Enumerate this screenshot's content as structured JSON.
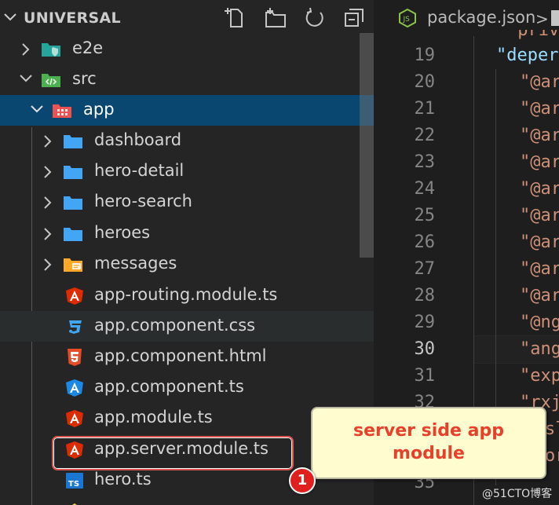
{
  "explorer": {
    "title": "UNIVERSAL",
    "rows": [
      {
        "label": "e2e",
        "icon": "folder-e2e-icon",
        "chevron": "right"
      },
      {
        "label": "src",
        "icon": "folder-src-icon",
        "chevron": "down"
      },
      {
        "label": "app",
        "icon": "folder-app-icon",
        "chevron": "down"
      },
      {
        "label": "dashboard",
        "icon": "folder-icon",
        "chevron": "right"
      },
      {
        "label": "hero-detail",
        "icon": "folder-icon",
        "chevron": "right"
      },
      {
        "label": "hero-search",
        "icon": "folder-icon",
        "chevron": "right"
      },
      {
        "label": "heroes",
        "icon": "folder-icon",
        "chevron": "right"
      },
      {
        "label": "messages",
        "icon": "folder-messages-icon",
        "chevron": "right"
      },
      {
        "label": "app-routing.module.ts",
        "icon": "angular-icon"
      },
      {
        "label": "app.component.css",
        "icon": "css-icon"
      },
      {
        "label": "app.component.html",
        "icon": "html-icon"
      },
      {
        "label": "app.component.ts",
        "icon": "angular-component-icon"
      },
      {
        "label": "app.module.ts",
        "icon": "angular-icon"
      },
      {
        "label": "app.server.module.ts",
        "icon": "angular-icon"
      },
      {
        "label": "hero.ts",
        "icon": "typescript-icon"
      }
    ]
  },
  "editor": {
    "tab_label": "package.json",
    "crumb_separator": ">",
    "line_numbers": [
      "19",
      "20",
      "21",
      "22",
      "23",
      "24",
      "25",
      "26",
      "27",
      "28",
      "29",
      "30",
      "31",
      "32",
      "35"
    ],
    "code_lines": [
      "\"deper",
      "\"@ar",
      "\"@ar",
      "\"@ar",
      "\"@ar",
      "\"@ar",
      "\"@ar",
      "\"@ar",
      "\"@ar",
      "\"@ar",
      "\"@ng",
      "\"ang",
      "\"exp",
      "\"rxj"
    ],
    "partial_top": "\"privc",
    "partial_tail": [
      "sl",
      "or"
    ]
  },
  "callout": {
    "text": "server side app\nmodule",
    "badge": "1"
  },
  "watermark": "@51CTO博客",
  "colors": {
    "selected_row": "#094771",
    "folder_blue": "#42a5f5",
    "angular_red": "#dd2c00",
    "callout_text": "#e8402a"
  }
}
